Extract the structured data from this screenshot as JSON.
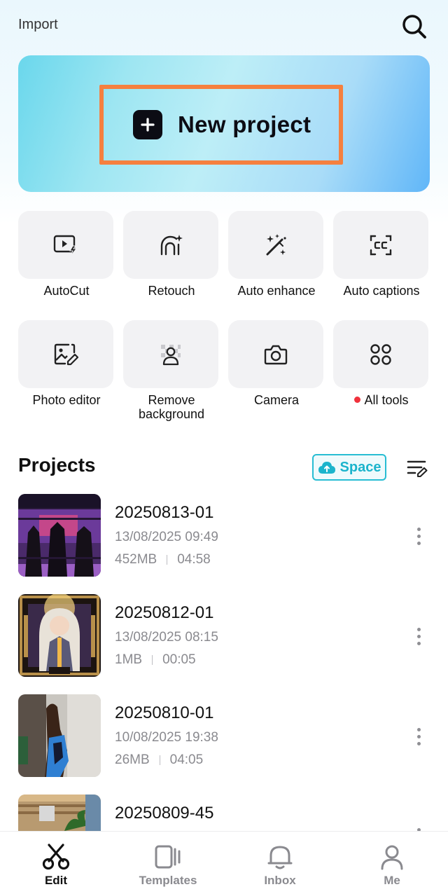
{
  "header": {
    "import_label": "Import"
  },
  "hero": {
    "new_project_label": "New project"
  },
  "tools": [
    {
      "label": "AutoCut",
      "icon": "autocut-icon"
    },
    {
      "label": "Retouch",
      "icon": "retouch-icon"
    },
    {
      "label": "Auto enhance",
      "icon": "magic-wand-icon"
    },
    {
      "label": "Auto captions",
      "icon": "captions-icon"
    },
    {
      "label": "Photo editor",
      "icon": "photo-edit-icon"
    },
    {
      "label": "Remove background",
      "icon": "remove-background-icon"
    },
    {
      "label": "Camera",
      "icon": "camera-icon"
    },
    {
      "label": "All tools",
      "icon": "grid-dots-icon",
      "badge": "red-dot"
    }
  ],
  "projects_section": {
    "title": "Projects",
    "space_label": "Space"
  },
  "projects": [
    {
      "name": "20250813-01",
      "date": "13/08/2025 09:49",
      "size": "452MB",
      "duration": "04:58"
    },
    {
      "name": "20250812-01",
      "date": "13/08/2025 08:15",
      "size": "1MB",
      "duration": "00:05"
    },
    {
      "name": "20250810-01",
      "date": "10/08/2025 19:38",
      "size": "26MB",
      "duration": "04:05"
    },
    {
      "name": "20250809-45",
      "date": "",
      "size": "",
      "duration": ""
    }
  ],
  "tabs": [
    {
      "label": "Edit",
      "icon": "scissors-icon",
      "active": true
    },
    {
      "label": "Templates",
      "icon": "templates-icon",
      "active": false
    },
    {
      "label": "Inbox",
      "icon": "bell-icon",
      "active": false
    },
    {
      "label": "Me",
      "icon": "person-icon",
      "active": false
    }
  ],
  "colors": {
    "accent": "#27bdd3",
    "highlight": "#f5803f",
    "badge": "#f0323c"
  }
}
